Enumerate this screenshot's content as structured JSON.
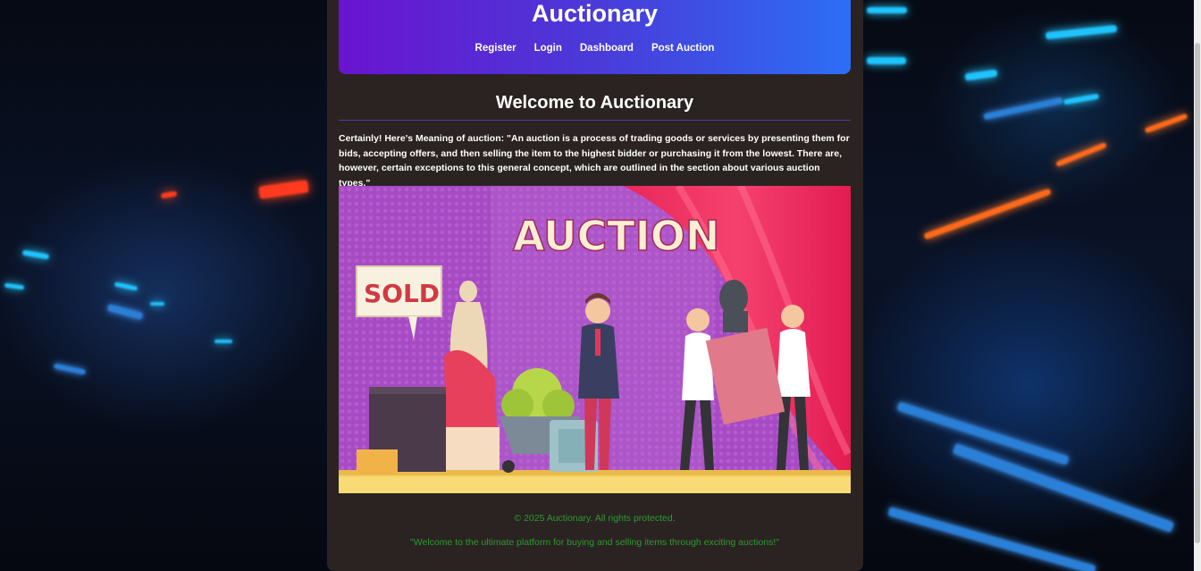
{
  "header": {
    "title": "Auctionary",
    "nav": [
      "Register",
      "Login",
      "Dashboard",
      "Post Auction"
    ]
  },
  "main": {
    "heading": "Welcome to Auctionary",
    "intro": "Certainly! Here's Meaning of auction: \"An auction is a process of trading goods or services by presenting them for bids, accepting offers, and then selling the item to the highest bidder or purchasing it from the lowest. There are, however, certain exceptions to this general concept, which are outlined in the section about various auction types.\"",
    "hero": {
      "banner_text": "AUCTION",
      "sign_text": "SOLD"
    }
  },
  "footer": {
    "copyright": "© 2025 Auctionary. All rights protected.",
    "tagline": "\"Welcome to the ultimate platform for buying and selling items through exciting auctions!\""
  },
  "colors": {
    "header_gradient_start": "#6a14d0",
    "header_gradient_end": "#2c6ef5",
    "panel_background": "#2a2322",
    "footer_text": "#2e9a2e"
  }
}
